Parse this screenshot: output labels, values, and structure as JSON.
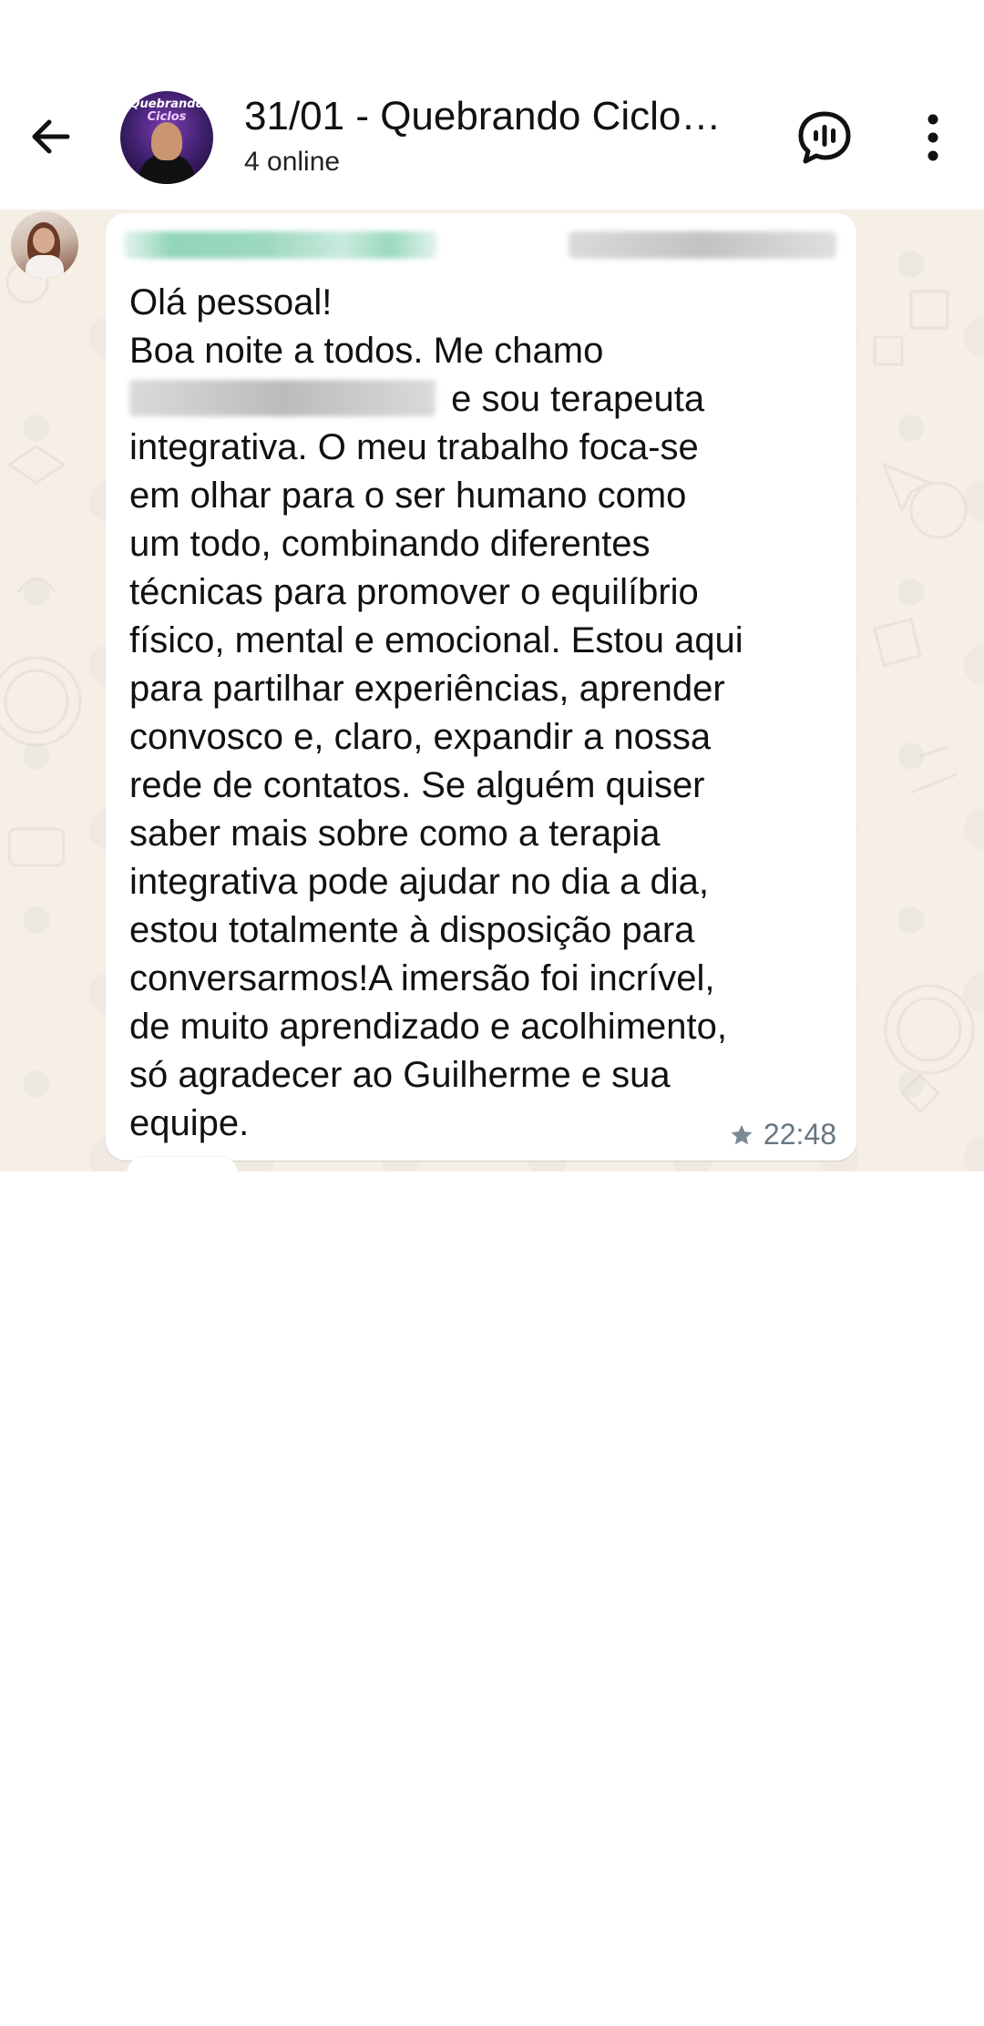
{
  "header": {
    "back_icon": "arrow-left-icon",
    "avatar": {
      "line1": "Quebrando",
      "line2": "Ciclos"
    },
    "title": "31/01 - Quebrando Ciclo…",
    "subtitle": "4 online",
    "call_icon": "voice-chat-icon",
    "menu_icon": "more-vert-icon"
  },
  "message": {
    "lines": [
      "Olá pessoal!",
      "Boa noite a todos. Me chamo",
      " e sou terapeuta",
      "integrativa. O meu trabalho foca-se",
      "em olhar para o ser humano como",
      "um todo, combinando diferentes",
      "técnicas para promover o equilíbrio",
      "físico, mental e emocional. Estou aqui",
      "para partilhar experiências, aprender",
      "convosco e, claro, expandir a nossa",
      "rede de contatos. Se alguém quiser",
      "saber mais sobre como a terapia",
      "integrativa pode ajudar no dia a dia,",
      "estou totalmente à disposição para",
      "conversarmos!A imersão foi incrível,",
      "de muito aprendizado e acolhimento,",
      "só agradecer ao Guilherme e sua",
      "equipe."
    ],
    "time": "22:48",
    "starred_icon": "star-icon"
  },
  "colors": {
    "chat_bg": "#f5efe6",
    "bubble_bg": "#ffffff",
    "meta_text": "#667781",
    "name_blur": "#4ab98c"
  }
}
